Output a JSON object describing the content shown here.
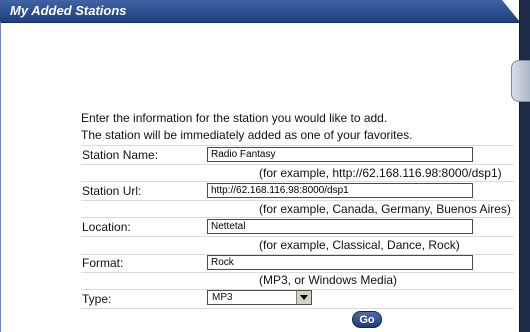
{
  "panel": {
    "title": "My Added Stations"
  },
  "intro": {
    "line1": "Enter the information for the station you would like to add.",
    "line2": "The station will be immediately added as one of your favorites."
  },
  "form": {
    "station_name": {
      "label": "Station Name:",
      "value": "Radio Fantasy",
      "hint": ""
    },
    "station_url": {
      "label": "Station Url:",
      "value": "http://62.168.116.98:8000/dsp1",
      "hint": "(for example, http://62.168.116.98:8000/dsp1)"
    },
    "location": {
      "label": "Location:",
      "value": "Nettetal",
      "hint": "(for example, Canada, Germany, Buenos Aires)"
    },
    "format": {
      "label": "Format:",
      "value": "Rock",
      "hint": "(for example, Classical, Dance, Rock)"
    },
    "type": {
      "label": "Type:",
      "selected": "MP3",
      "hint": "(MP3, or Windows Media)"
    }
  },
  "go_label": "Go",
  "colors": {
    "titlebar": "#2a4a8c",
    "button": "#2d4b86"
  }
}
